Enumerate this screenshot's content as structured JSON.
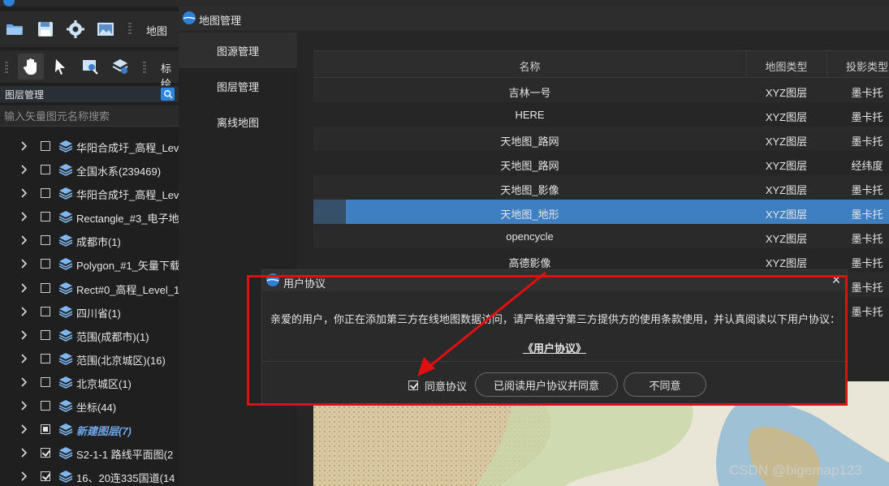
{
  "toolbar": {
    "map_label": "地图",
    "mark_label": "标绘"
  },
  "layer_panel": {
    "title": "图层管理",
    "search_placeholder": "输入矢量图元名称搜索",
    "layers": [
      {
        "name": "华阳合成圩_高程_Leve",
        "state": "unchecked",
        "style": "normal"
      },
      {
        "name": "全国水系(239469)",
        "state": "unchecked",
        "style": "normal"
      },
      {
        "name": "华阳合成圩_高程_Leve",
        "state": "unchecked",
        "style": "normal"
      },
      {
        "name": "Rectangle_#3_电子地",
        "state": "unchecked",
        "style": "normal"
      },
      {
        "name": "成都市(1)",
        "state": "unchecked",
        "style": "normal"
      },
      {
        "name": "Polygon_#1_矢量下载",
        "state": "unchecked",
        "style": "normal"
      },
      {
        "name": "Rect#0_高程_Level_1",
        "state": "unchecked",
        "style": "normal"
      },
      {
        "name": "四川省(1)",
        "state": "unchecked",
        "style": "normal"
      },
      {
        "name": "范围(成都市)(1)",
        "state": "unchecked",
        "style": "normal"
      },
      {
        "name": "范围(北京城区)(16)",
        "state": "unchecked",
        "style": "normal"
      },
      {
        "name": "北京城区(1)",
        "state": "unchecked",
        "style": "normal"
      },
      {
        "name": "坐标(44)",
        "state": "unchecked",
        "style": "normal"
      },
      {
        "name": "新建图层(7)",
        "state": "partial",
        "style": "new"
      },
      {
        "name": "S2-1-1 路线平面图(2",
        "state": "checked",
        "style": "normal"
      },
      {
        "name": "16、20连335国道(14",
        "state": "checked",
        "style": "normal"
      }
    ]
  },
  "map_manager": {
    "title": "地图管理",
    "nav": [
      "图源管理",
      "图层管理",
      "离线地图"
    ],
    "table": {
      "headers": {
        "name": "名称",
        "type": "地图类型",
        "proj": "投影类型"
      },
      "rows": [
        {
          "name": "吉林一号",
          "type": "XYZ图层",
          "proj": "墨卡托"
        },
        {
          "name": "HERE",
          "type": "XYZ图层",
          "proj": "墨卡托"
        },
        {
          "name": "天地图_路网",
          "type": "XYZ图层",
          "proj": "墨卡托"
        },
        {
          "name": "天地图_路网",
          "type": "XYZ图层",
          "proj": "经纬度"
        },
        {
          "name": "天地图_影像",
          "type": "XYZ图层",
          "proj": "墨卡托"
        },
        {
          "name": "天地图_地形",
          "type": "XYZ图层",
          "proj": "墨卡托",
          "selected": true
        },
        {
          "name": "opencycle",
          "type": "XYZ图层",
          "proj": "墨卡托"
        },
        {
          "name": "高德影像",
          "type": "XYZ图层",
          "proj": "墨卡托"
        },
        {
          "name": "",
          "type": "",
          "proj": "墨卡托"
        },
        {
          "name": "",
          "type": "",
          "proj": "墨卡托"
        }
      ]
    }
  },
  "dialog": {
    "title": "用户协议",
    "close": "×",
    "message": "亲爱的用户，你正在添加第三方在线地图数据访问，请严格遵守第三方提供方的使用条款使用，并认真阅读以下用户协议：",
    "link": "《用户协议》",
    "agree_label": "同意协议",
    "agree_checked": true,
    "accept_button": "已阅读用户协议并同意",
    "reject_button": "不同意"
  },
  "watermark": "CSDN @bigemap123",
  "colors": {
    "accent": "#3d7fc1",
    "highlight_red": "#e01010",
    "background": "#1f1f1f"
  }
}
